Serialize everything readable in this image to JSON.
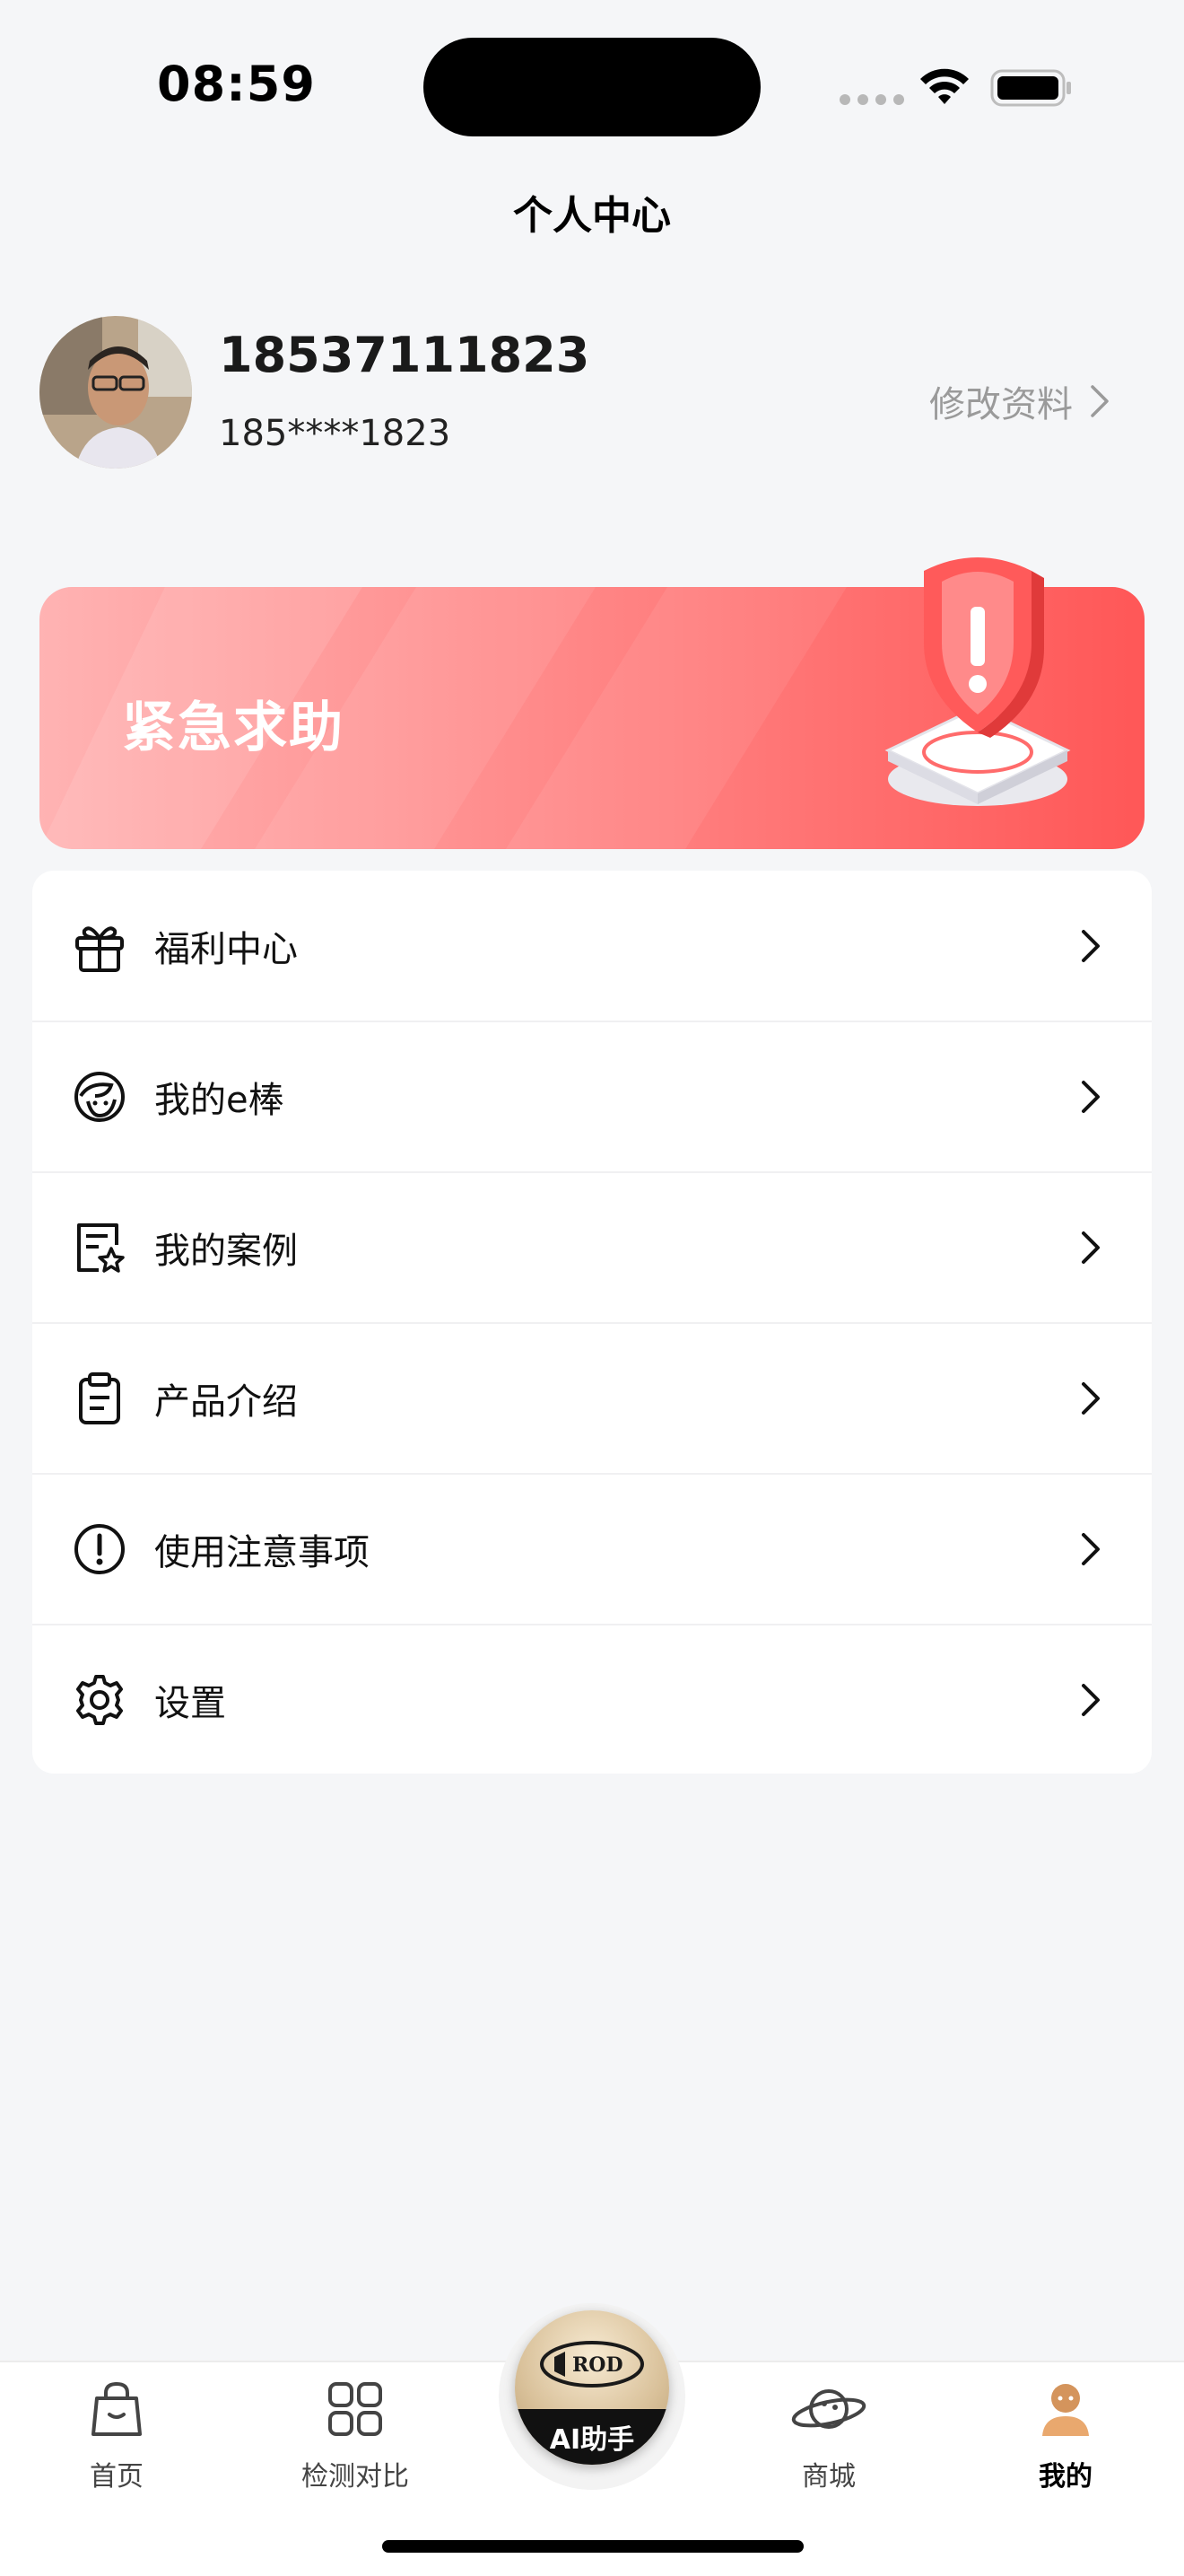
{
  "status_bar": {
    "time": "08:59"
  },
  "header": {
    "title": "个人中心"
  },
  "profile": {
    "name": "18537111823",
    "phone_masked": "185****1823",
    "edit_label": "修改资料"
  },
  "banner": {
    "label": "紧急求助"
  },
  "menu": {
    "items": [
      {
        "label": "福利中心",
        "icon": "gift-icon"
      },
      {
        "label": "我的e棒",
        "icon": "face-icon"
      },
      {
        "label": "我的案例",
        "icon": "case-star-icon"
      },
      {
        "label": "产品介绍",
        "icon": "clipboard-icon"
      },
      {
        "label": "使用注意事项",
        "icon": "alert-circle-icon"
      },
      {
        "label": "设置",
        "icon": "gear-icon"
      }
    ]
  },
  "tabbar": {
    "items": [
      {
        "label": "首页",
        "icon": "shopping-bag-icon"
      },
      {
        "label": "检测对比",
        "icon": "grid-icon"
      },
      {
        "label": "商城",
        "icon": "planet-icon"
      },
      {
        "label": "我的",
        "icon": "user-avatar-icon",
        "active": true
      }
    ],
    "center": {
      "logo_text": "ROD",
      "label": "AI助手"
    }
  },
  "colors": {
    "banner_start": "#ffb3b3",
    "banner_end": "#ff5757",
    "background": "#f5f6f8"
  }
}
